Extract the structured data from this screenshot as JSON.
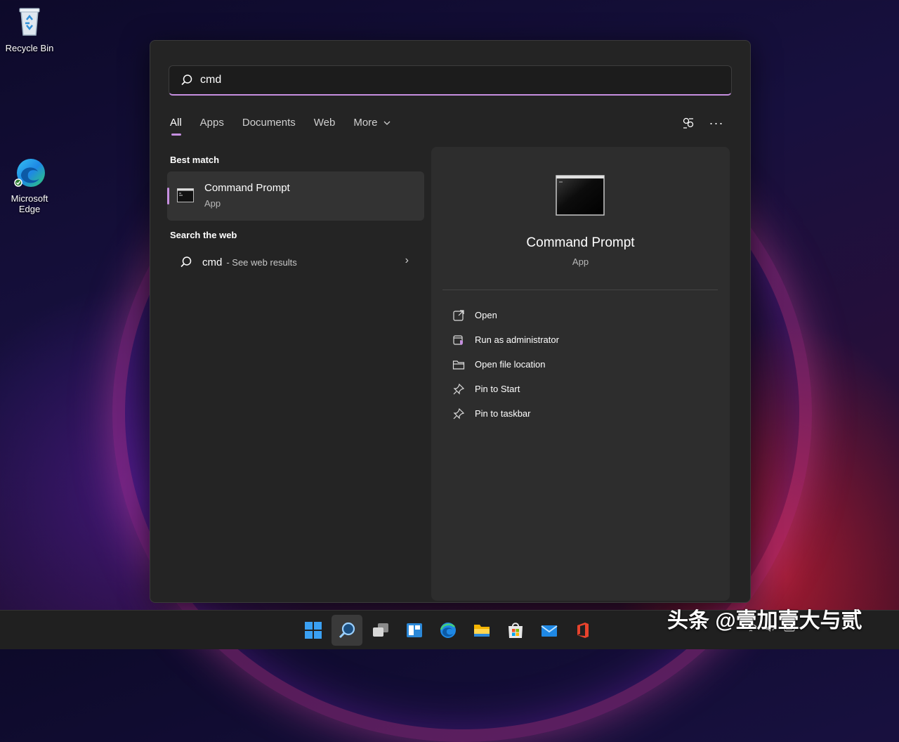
{
  "desktop": {
    "icons": [
      {
        "label": "Recycle Bin",
        "icon": "recycle-bin-icon"
      },
      {
        "label": "Microsoft Edge",
        "icon": "edge-icon"
      }
    ]
  },
  "search": {
    "query": "cmd",
    "placeholder": ""
  },
  "tabs": [
    {
      "label": "All",
      "active": true
    },
    {
      "label": "Apps"
    },
    {
      "label": "Documents"
    },
    {
      "label": "Web"
    },
    {
      "label": "More"
    }
  ],
  "toolbar": {
    "share_icon": "share-icon",
    "more_icon": "ellipsis-icon",
    "more_glyph": "···"
  },
  "best_match": {
    "section_title": "Best match",
    "title": "Command Prompt",
    "subtitle": "App"
  },
  "web_search": {
    "section_title": "Search the web",
    "query": "cmd",
    "suffix": "- See web results",
    "arrow": "›"
  },
  "detail": {
    "title": "Command Prompt",
    "subtitle": "App",
    "actions": [
      {
        "label": "Open",
        "icon": "open-external-icon"
      },
      {
        "label": "Run as administrator",
        "icon": "shield-admin-icon"
      },
      {
        "label": "Open file location",
        "icon": "folder-icon"
      },
      {
        "label": "Pin to Start",
        "icon": "pin-icon"
      },
      {
        "label": "Pin to taskbar",
        "icon": "pin-icon"
      }
    ]
  },
  "taskbar": {
    "items": [
      "start-icon",
      "search-icon",
      "task-view-icon",
      "widgets-icon",
      "edge-icon",
      "file-explorer-icon",
      "store-icon",
      "mail-icon",
      "office-icon"
    ],
    "active_index": 1
  },
  "watermark": "头条 @壹加壹大与贰",
  "colors": {
    "accent": "#c68fe0",
    "panel": "#242424",
    "detail": "#2d2d2d"
  }
}
